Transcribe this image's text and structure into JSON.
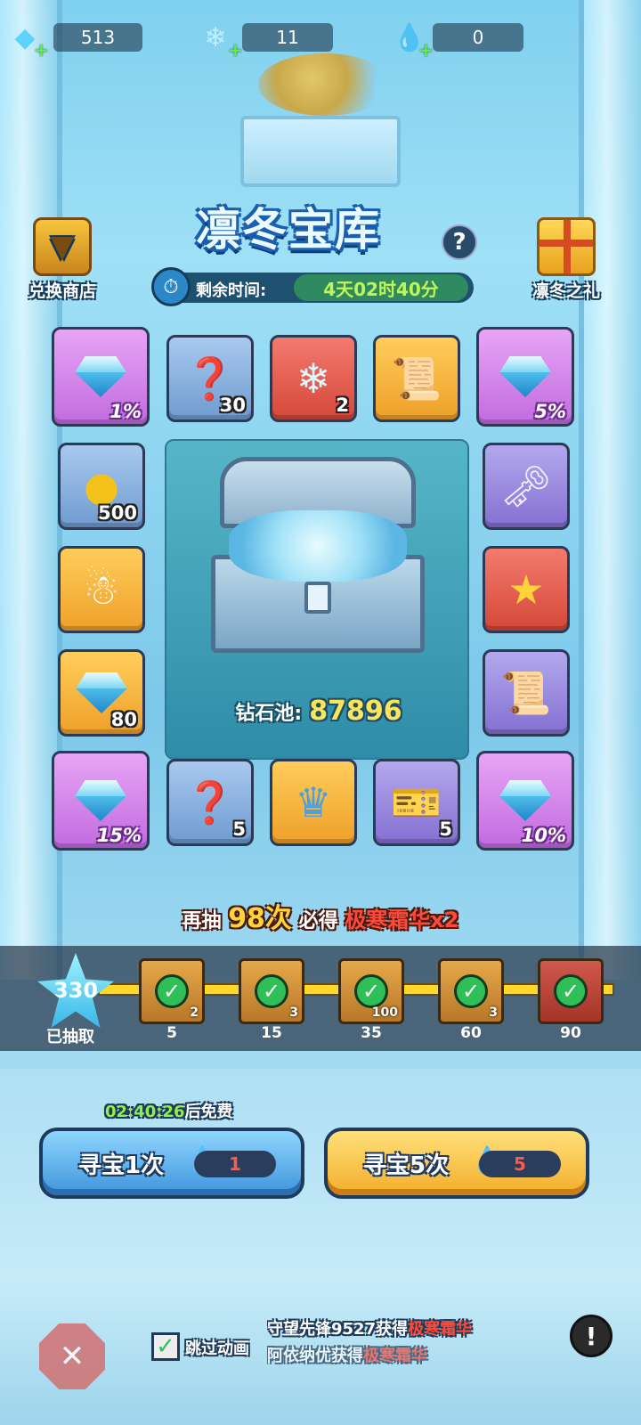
{
  "currencies": [
    {
      "icon": "diamond-icon",
      "value": "513"
    },
    {
      "icon": "snowflake-icon",
      "value": "11"
    },
    {
      "icon": "ice-drop-icon",
      "value": "0"
    }
  ],
  "title": "凛冬宝库",
  "help_label": "?",
  "timer": {
    "label": "剩余时间:",
    "value": "4天02时40分"
  },
  "side": {
    "shop_label": "兑换商店",
    "gift_label": "凛冬之礼"
  },
  "tiles": {
    "t1": {
      "icon": "diamond-icon",
      "pct": "1%"
    },
    "t2": {
      "icon": "mystery-orb-icon",
      "count": "30"
    },
    "t3": {
      "icon": "snowflake-icon",
      "count": "2"
    },
    "t4": {
      "icon": "red-scroll-icon"
    },
    "t5": {
      "icon": "diamond-icon",
      "pct": "5%"
    },
    "t6": {
      "icon": "gold-coin-icon",
      "count": "500"
    },
    "t7": {
      "icon": "key-icon"
    },
    "t8": {
      "icon": "snow-spirit-icon"
    },
    "t9": {
      "icon": "hero-pack-icon"
    },
    "t10": {
      "icon": "diamond-icon",
      "count": "80"
    },
    "t11": {
      "icon": "purple-scroll-icon"
    },
    "t12": {
      "icon": "diamond-icon",
      "pct": "15%"
    },
    "t13": {
      "icon": "mystery-scroll-icon",
      "count": "5"
    },
    "t14": {
      "icon": "ice-hero-icon"
    },
    "t15": {
      "icon": "ticket-icon",
      "count": "5"
    },
    "t16": {
      "icon": "diamond-icon",
      "pct": "10%"
    }
  },
  "pool": {
    "label": "钻石池:",
    "value": "87896"
  },
  "guarantee": {
    "prefix": "再抽",
    "count": "98次",
    "middle": "必得",
    "reward": "极寒霜华x2"
  },
  "progress": {
    "drawn_count": "330",
    "drawn_label": "已抽取",
    "milestones": [
      {
        "value": "5",
        "reward_count": "2",
        "claimed": true
      },
      {
        "value": "15",
        "reward_count": "3",
        "claimed": true
      },
      {
        "value": "35",
        "reward_count": "100",
        "claimed": true
      },
      {
        "value": "60",
        "reward_count": "3",
        "claimed": true
      },
      {
        "value": "90",
        "reward_count": "",
        "claimed": true
      }
    ]
  },
  "free_timer": {
    "time": "02:40:26",
    "suffix": "后免费"
  },
  "buttons": {
    "single": {
      "label": "寻宝1次",
      "cost": "1"
    },
    "multi": {
      "label": "寻宝5次",
      "cost": "5"
    }
  },
  "skip": {
    "label": "跳过动画",
    "checked": true
  },
  "ticker": [
    {
      "prefix": "守望先锋9527获得",
      "reward": "极寒霜华"
    },
    {
      "prefix": "阿依纳优获得",
      "reward": "极寒霜华"
    }
  ],
  "colors": {
    "accent_gold": "#ffd43a",
    "reward_red": "#ff4a3a",
    "timer_green": "#bff55b"
  }
}
